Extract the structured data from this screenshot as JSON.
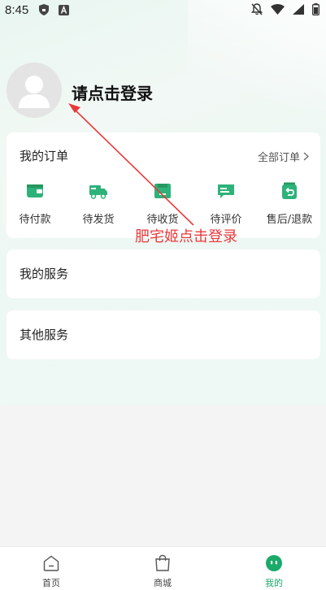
{
  "status_bar": {
    "time": "8:45"
  },
  "header": {
    "login_prompt": "请点击登录"
  },
  "orders": {
    "title": "我的订单",
    "all_label": "全部订单",
    "items": [
      {
        "label": "待付款",
        "icon": "wallet-icon"
      },
      {
        "label": "待发货",
        "icon": "truck-icon"
      },
      {
        "label": "待收货",
        "icon": "box-icon"
      },
      {
        "label": "待评价",
        "icon": "review-icon"
      },
      {
        "label": "售后/退款",
        "icon": "refund-icon"
      }
    ]
  },
  "services": {
    "title": "我的服务"
  },
  "other_services": {
    "title": "其他服务"
  },
  "annotation": {
    "text": "肥宅姬点击登录"
  },
  "tabbar": {
    "items": [
      {
        "label": "首页",
        "icon": "home-icon",
        "active": false
      },
      {
        "label": "商城",
        "icon": "bag-icon",
        "active": false
      },
      {
        "label": "我的",
        "icon": "profile-icon",
        "active": true
      }
    ]
  },
  "colors": {
    "accent": "#1aaa6a",
    "annotation": "#e83a3a",
    "icon_green": "#2db27a"
  }
}
